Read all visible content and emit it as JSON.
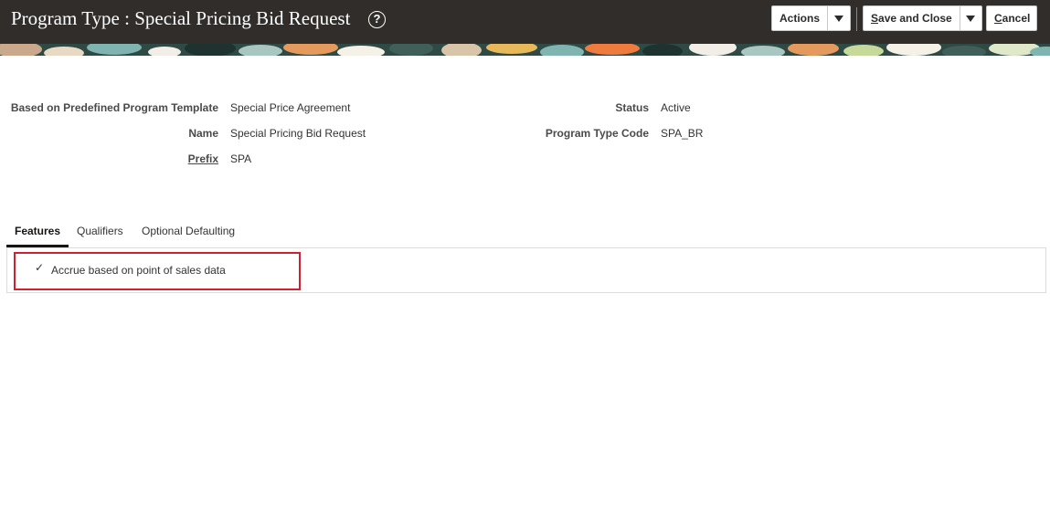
{
  "header": {
    "title": "Program Type : Special Pricing Bid Request",
    "help_icon": "question-circle-icon",
    "actions_label": "Actions",
    "save_and_close_prefix": "S",
    "save_and_close_rest": "ave and Close",
    "cancel_prefix": "C",
    "cancel_rest": "ancel"
  },
  "form": {
    "template_label": "Based on Predefined Program Template",
    "template_value": "Special Price Agreement",
    "name_label": "Name",
    "name_value": "Special Pricing Bid Request",
    "prefix_label": "Prefix",
    "prefix_value": "SPA",
    "status_label": "Status",
    "status_value": "Active",
    "code_label": "Program Type Code",
    "code_value": "SPA_BR"
  },
  "tabs": [
    {
      "label": "Features",
      "active": true
    },
    {
      "label": "Qualifiers",
      "active": false
    },
    {
      "label": "Optional Defaulting",
      "active": false
    }
  ],
  "features": {
    "items": [
      {
        "label": "Accrue based on point of sales data",
        "checked": true
      }
    ],
    "check_glyph": "✓"
  },
  "colors": {
    "header_bg": "#302d2a",
    "highlight": "#d1202f",
    "banner_teal": "#2f4a45"
  }
}
